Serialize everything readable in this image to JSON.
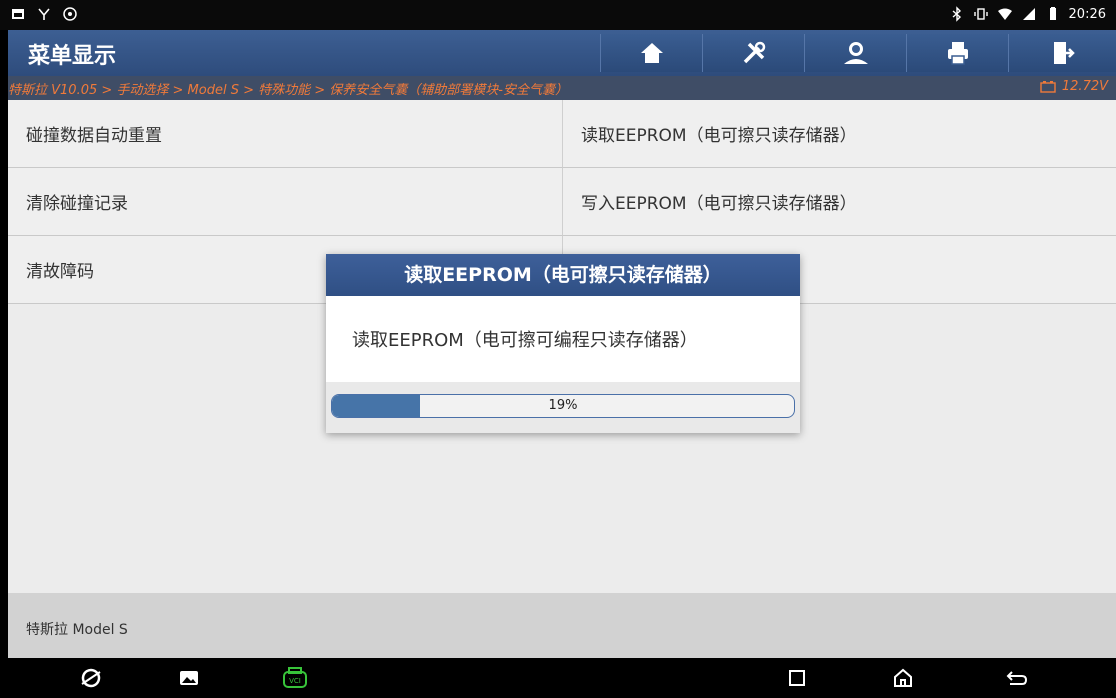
{
  "status_bar": {
    "left_icons": [
      "notification-icon",
      "usb-debug-icon",
      "settings-app-icon"
    ],
    "right_icons": [
      "bluetooth-icon",
      "vibrate-icon",
      "wifi-icon",
      "signal-icon",
      "battery-icon"
    ],
    "time": "20:26"
  },
  "header": {
    "title": "菜单显示",
    "buttons": [
      "home-icon",
      "tools-icon",
      "user-icon",
      "print-icon",
      "exit-icon"
    ]
  },
  "breadcrumb": {
    "path": "特斯拉 V10.05 > 手动选择 > Model S > 特殊功能 > 保养安全气囊（辅助部署模块-安全气囊）",
    "voltage": "12.72V"
  },
  "menu": {
    "items": [
      {
        "label": "碰撞数据自动重置"
      },
      {
        "label": "读取EEPROM（电可擦只读存储器）"
      },
      {
        "label": "清除碰撞记录"
      },
      {
        "label": "写入EEPROM（电可擦只读存储器）"
      },
      {
        "label": "清故障码"
      },
      {
        "label": ""
      }
    ]
  },
  "footer": {
    "model": "特斯拉 Model S"
  },
  "modal": {
    "title": "读取EEPROM（电可擦只读存储器）",
    "message": "读取EEPROM（电可擦可编程只读存储器）",
    "progress": 0.19,
    "progress_text": "19%"
  },
  "nav_bar": {
    "icons": [
      "browser-icon",
      "gallery-icon",
      "vci-icon",
      "recents-icon",
      "home-nav-icon",
      "back-icon"
    ]
  },
  "colors": {
    "header_blue": "#3d5f93",
    "breadcrumb_orange": "#f07a3a",
    "progress_fill": "#4674a8",
    "vci_green": "#38c43a"
  }
}
